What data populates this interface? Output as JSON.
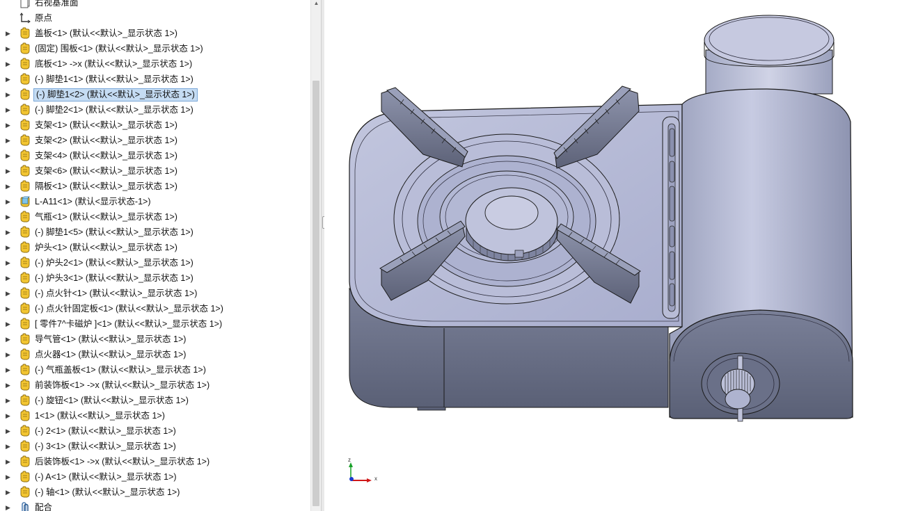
{
  "feature_tree": {
    "items": [
      {
        "label": "右视基准面",
        "icon": "plane-icon",
        "expandable": false,
        "selected": false
      },
      {
        "label": "原点",
        "icon": "origin-icon",
        "expandable": false,
        "selected": false
      },
      {
        "label": "盖板<1> (默认<<默认>_显示状态 1>)",
        "icon": "part-icon",
        "expandable": true,
        "selected": false
      },
      {
        "label": "(固定) 围板<1> (默认<<默认>_显示状态 1>)",
        "icon": "part-icon",
        "expandable": true,
        "selected": false
      },
      {
        "label": "底板<1> ->x (默认<<默认>_显示状态 1>)",
        "icon": "part-icon",
        "expandable": true,
        "selected": false
      },
      {
        "label": "(-) 脚垫1<1> (默认<<默认>_显示状态 1>)",
        "icon": "part-icon",
        "expandable": true,
        "selected": false
      },
      {
        "label": "(-) 脚垫1<2> (默认<<默认>_显示状态 1>)",
        "icon": "part-icon",
        "expandable": true,
        "selected": true
      },
      {
        "label": "(-) 脚垫2<1> (默认<<默认>_显示状态 1>)",
        "icon": "part-icon",
        "expandable": true,
        "selected": false
      },
      {
        "label": "支架<1> (默认<<默认>_显示状态 1>)",
        "icon": "part-icon",
        "expandable": true,
        "selected": false
      },
      {
        "label": "支架<2> (默认<<默认>_显示状态 1>)",
        "icon": "part-icon",
        "expandable": true,
        "selected": false
      },
      {
        "label": "支架<4> (默认<<默认>_显示状态 1>)",
        "icon": "part-icon",
        "expandable": true,
        "selected": false
      },
      {
        "label": "支架<6> (默认<<默认>_显示状态 1>)",
        "icon": "part-icon",
        "expandable": true,
        "selected": false
      },
      {
        "label": "隔板<1> (默认<<默认>_显示状态 1>)",
        "icon": "part-icon",
        "expandable": true,
        "selected": false
      },
      {
        "label": "L-A11<1> (默认<显示状态-1>)",
        "icon": "assembly-icon",
        "expandable": true,
        "selected": false
      },
      {
        "label": "气瓶<1> (默认<<默认>_显示状态 1>)",
        "icon": "part-icon",
        "expandable": true,
        "selected": false
      },
      {
        "label": "(-) 脚垫1<5> (默认<<默认>_显示状态 1>)",
        "icon": "part-icon",
        "expandable": true,
        "selected": false
      },
      {
        "label": "炉头<1> (默认<<默认>_显示状态 1>)",
        "icon": "part-icon",
        "expandable": true,
        "selected": false
      },
      {
        "label": "(-) 炉头2<1> (默认<<默认>_显示状态 1>)",
        "icon": "part-icon",
        "expandable": true,
        "selected": false
      },
      {
        "label": "(-) 炉头3<1> (默认<<默认>_显示状态 1>)",
        "icon": "part-icon",
        "expandable": true,
        "selected": false
      },
      {
        "label": "(-) 点火针<1> (默认<<默认>_显示状态 1>)",
        "icon": "part-icon",
        "expandable": true,
        "selected": false
      },
      {
        "label": "(-) 点火针固定板<1> (默认<<默认>_显示状态 1>)",
        "icon": "part-icon",
        "expandable": true,
        "selected": false
      },
      {
        "label": "[ 零件7^卡磁炉 ]<1> (默认<<默认>_显示状态 1>)",
        "icon": "part-icon",
        "expandable": true,
        "selected": false
      },
      {
        "label": "导气管<1> (默认<<默认>_显示状态 1>)",
        "icon": "part-icon",
        "expandable": true,
        "selected": false
      },
      {
        "label": "点火器<1> (默认<<默认>_显示状态 1>)",
        "icon": "part-icon",
        "expandable": true,
        "selected": false
      },
      {
        "label": "(-) 气瓶盖板<1> (默认<<默认>_显示状态 1>)",
        "icon": "part-icon",
        "expandable": true,
        "selected": false
      },
      {
        "label": "前装饰板<1> ->x (默认<<默认>_显示状态 1>)",
        "icon": "part-icon",
        "expandable": true,
        "selected": false
      },
      {
        "label": "(-) 旋钮<1> (默认<<默认>_显示状态 1>)",
        "icon": "part-icon",
        "expandable": true,
        "selected": false
      },
      {
        "label": "1<1> (默认<<默认>_显示状态 1>)",
        "icon": "part-icon",
        "expandable": true,
        "selected": false
      },
      {
        "label": "(-) 2<1> (默认<<默认>_显示状态 1>)",
        "icon": "part-icon",
        "expandable": true,
        "selected": false
      },
      {
        "label": "(-) 3<1> (默认<<默认>_显示状态 1>)",
        "icon": "part-icon",
        "expandable": true,
        "selected": false
      },
      {
        "label": "后装饰板<1> ->x (默认<<默认>_显示状态 1>)",
        "icon": "part-icon",
        "expandable": true,
        "selected": false
      },
      {
        "label": "(-) A<1> (默认<<默认>_显示状态 1>)",
        "icon": "part-icon",
        "expandable": true,
        "selected": false
      },
      {
        "label": "(-) 轴<1> (默认<<默认>_显示状态 1>)",
        "icon": "part-icon",
        "expandable": true,
        "selected": false
      },
      {
        "label": "配合",
        "icon": "mates-icon",
        "expandable": true,
        "selected": false
      }
    ]
  },
  "triad": {
    "z_label": "z",
    "x_label": "x"
  },
  "colors": {
    "part_icon": "#f0c030",
    "selection_bg": "#c5dcf3",
    "model_face": "#b4b8d4",
    "model_dark": "#646a80",
    "edge": "#1a1a1a"
  }
}
